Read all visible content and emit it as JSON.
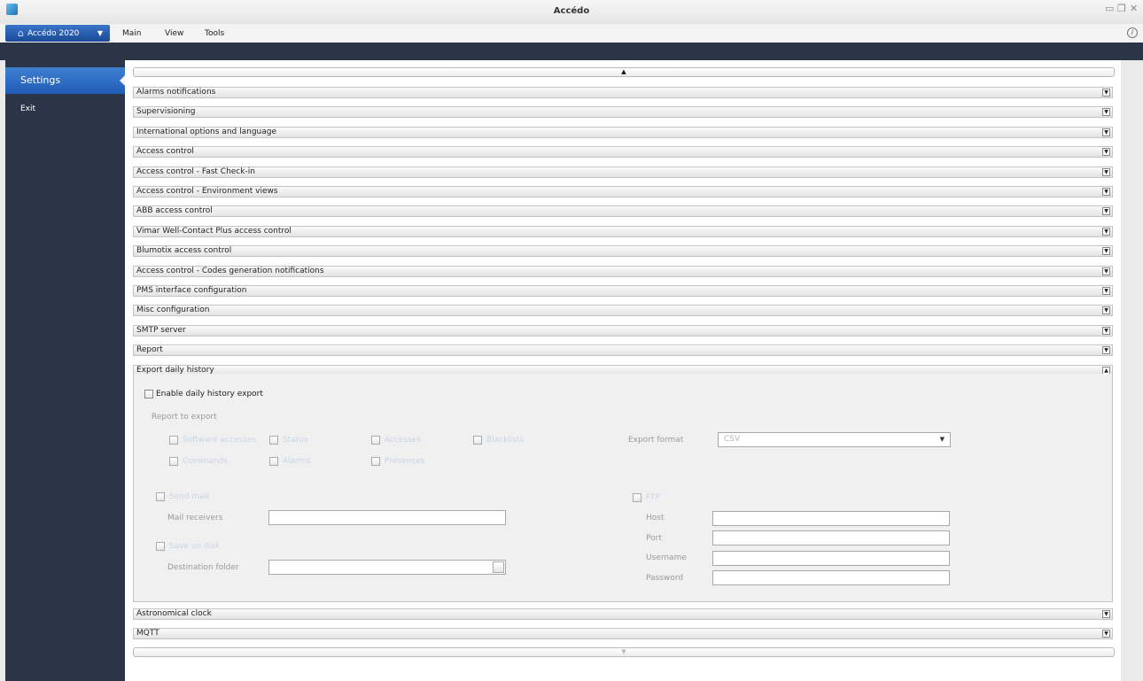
{
  "window": {
    "title": "Accédo",
    "controls": [
      "minimize-icon",
      "restore-icon",
      "close-icon"
    ]
  },
  "menubar": {
    "app_button": "Accédo 2020",
    "items": [
      "Main",
      "View",
      "Tools"
    ]
  },
  "sidebar": {
    "items": [
      {
        "label": "Settings",
        "active": true
      },
      {
        "label": "Exit",
        "active": false
      }
    ]
  },
  "sections_before": [
    "Alarms notifications",
    "Supervisioning",
    "International options and language",
    "Access control",
    "Access control - Fast Check-in",
    "Access control - Environment views",
    "ABB access control",
    "Vimar Well-Contact Plus access control",
    "Blumotix access control",
    "Access control - Codes generation notifications",
    "PMS interface configuration",
    "Misc configuration",
    "SMTP server",
    "Report",
    "Export daily history"
  ],
  "sections_after": [
    "Astronomical clock",
    "MQTT"
  ],
  "export_panel": {
    "enable_label": "Enable daily history export",
    "report_to_export_label": "Report to export",
    "report_options": [
      "Software accesses",
      "Status",
      "Accesses",
      "Blacklists",
      "Commands",
      "Alarms",
      "Presences"
    ],
    "export_format_label": "Export format",
    "export_format_value": "CSV",
    "send_mail_label": "Send mail",
    "mail_receivers_label": "Mail receivers",
    "mail_receivers_value": "",
    "save_on_disk_label": "Save on disk",
    "destination_folder_label": "Destination folder",
    "destination_folder_value": "",
    "ftp_label": "FTP",
    "host_label": "Host",
    "host_value": "",
    "port_label": "Port",
    "port_value": "",
    "username_label": "Username",
    "username_value": "",
    "password_label": "Password",
    "password_value": ""
  },
  "colors": {
    "sidebar_bg": "#2b3547",
    "active_item": "#2f6fc4",
    "section_header": "#e8e8e8"
  }
}
